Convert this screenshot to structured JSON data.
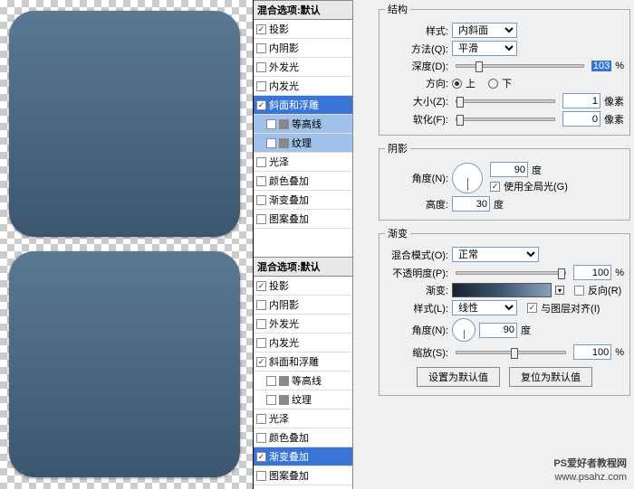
{
  "styleList": {
    "header": "混合选项:默认",
    "items": [
      {
        "label": "投影",
        "checked": true
      },
      {
        "label": "内阴影",
        "checked": false
      },
      {
        "label": "外发光",
        "checked": false
      },
      {
        "label": "内发光",
        "checked": false
      },
      {
        "label": "斜面和浮雕",
        "checked": true
      },
      {
        "label": "等高线",
        "checked": false,
        "sub": true
      },
      {
        "label": "纹理",
        "checked": false,
        "sub": true
      },
      {
        "label": "光泽",
        "checked": false
      },
      {
        "label": "颜色叠加",
        "checked": false
      },
      {
        "label": "渐变叠加",
        "checked": false
      },
      {
        "label": "图案叠加",
        "checked": false
      }
    ],
    "items2": [
      {
        "label": "投影",
        "checked": true
      },
      {
        "label": "内阴影",
        "checked": false
      },
      {
        "label": "外发光",
        "checked": false
      },
      {
        "label": "内发光",
        "checked": false
      },
      {
        "label": "斜面和浮雕",
        "checked": true
      },
      {
        "label": "等高线",
        "checked": false,
        "sub": true
      },
      {
        "label": "纹理",
        "checked": false,
        "sub": true
      },
      {
        "label": "光泽",
        "checked": false
      },
      {
        "label": "颜色叠加",
        "checked": false
      },
      {
        "label": "渐变叠加",
        "checked": true
      },
      {
        "label": "图案叠加",
        "checked": false
      }
    ],
    "sel1": "斜面和浮雕",
    "sel2": "渐变叠加"
  },
  "structure": {
    "legend": "结构",
    "styleLabel": "样式:",
    "styleValue": "内斜面",
    "methodLabel": "方法(Q):",
    "methodValue": "平滑",
    "depthLabel": "深度(D):",
    "depthValue": "103",
    "depthUnit": "%",
    "directionLabel": "方向:",
    "up": "上",
    "down": "下",
    "sizeLabel": "大小(Z):",
    "sizeValue": "1",
    "sizeUnit": "像素",
    "softenLabel": "软化(F):",
    "softenValue": "0",
    "softenUnit": "像素"
  },
  "shadow": {
    "legend": "阴影",
    "angleLabel": "角度(N):",
    "angleValue": "90",
    "angleUnit": "度",
    "globalLight": "使用全局光(G)",
    "altitudeLabel": "高度:",
    "altitudeValue": "30",
    "altitudeUnit": "度"
  },
  "gradient": {
    "legend": "渐变",
    "blendLabel": "混合模式(O):",
    "blendValue": "正常",
    "opacityLabel": "不透明度(P):",
    "opacityValue": "100",
    "opacityUnit": "%",
    "gradLabel": "渐变:",
    "reverse": "反向(R)",
    "styleLabel2": "样式(L):",
    "styleValue2": "线性",
    "alignLayer": "与图层对齐(I)",
    "angleLabel": "角度(N):",
    "angleValue": "90",
    "angleUnit": "度",
    "scaleLabel": "缩放(S):",
    "scaleValue": "100",
    "scaleUnit": "%",
    "setDefault": "设置为默认值",
    "resetDefault": "复位为默认值"
  },
  "watermark": {
    "l1": "PS爱好者教程网",
    "l2": "www.psahz.com"
  }
}
